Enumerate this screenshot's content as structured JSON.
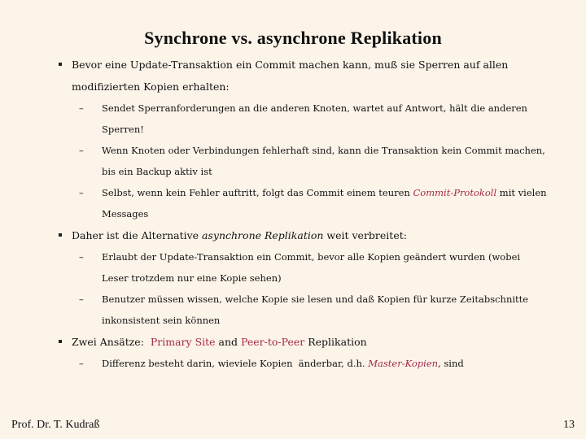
{
  "title": "Synchrone vs. asynchrone Replikation",
  "colors": {
    "background": "#fdf4e9",
    "accent": "#a3284a",
    "text": "#111111"
  },
  "bullets": [
    {
      "text": "Bevor eine Update-Transaktion ein Commit machen kann, muß sie Sperren auf allen modifizierten Kopien erhalten:",
      "subs": [
        {
          "text": "Sendet Sperranforderungen an die anderen Knoten, wartet auf Antwort, hält die anderen Sperren!"
        },
        {
          "text": "Wenn Knoten oder Verbindungen fehlerhaft sind, kann die Transaktion kein Commit machen, bis ein Backup aktiv ist"
        },
        {
          "pre": "Selbst, wenn kein Fehler auftritt, folgt das Commit einem teuren ",
          "em": "Commit-Protokoll",
          "post": " mit vielen Messages"
        }
      ]
    },
    {
      "pre": "Daher ist die Alternative ",
      "em": "asynchrone Replikation",
      "post": " weit verbreitet:",
      "subs": [
        {
          "text": "Erlaubt der Update-Transaktion ein Commit, bevor alle Kopien geändert wurden (wobei Leser trotzdem nur eine Kopie sehen)"
        },
        {
          "text": "Benutzer müssen wissen, welche Kopie sie lesen und daß Kopien für kurze Zeitabschnitte inkonsistent sein können"
        }
      ]
    },
    {
      "pre": "Zwei Ansätze:  ",
      "accent1": "Primary Site",
      "mid": " and ",
      "accent2": "Peer-to-Peer",
      "post": " Replikation",
      "subs": [
        {
          "pre": "Differenz besteht darin, wieviele Kopien  änderbar, d.h. ",
          "em": "Master-Kopien",
          "post": ", sind"
        }
      ]
    }
  ],
  "footer": {
    "author": "Prof. Dr. T. Kudraß",
    "page_number": "13"
  }
}
